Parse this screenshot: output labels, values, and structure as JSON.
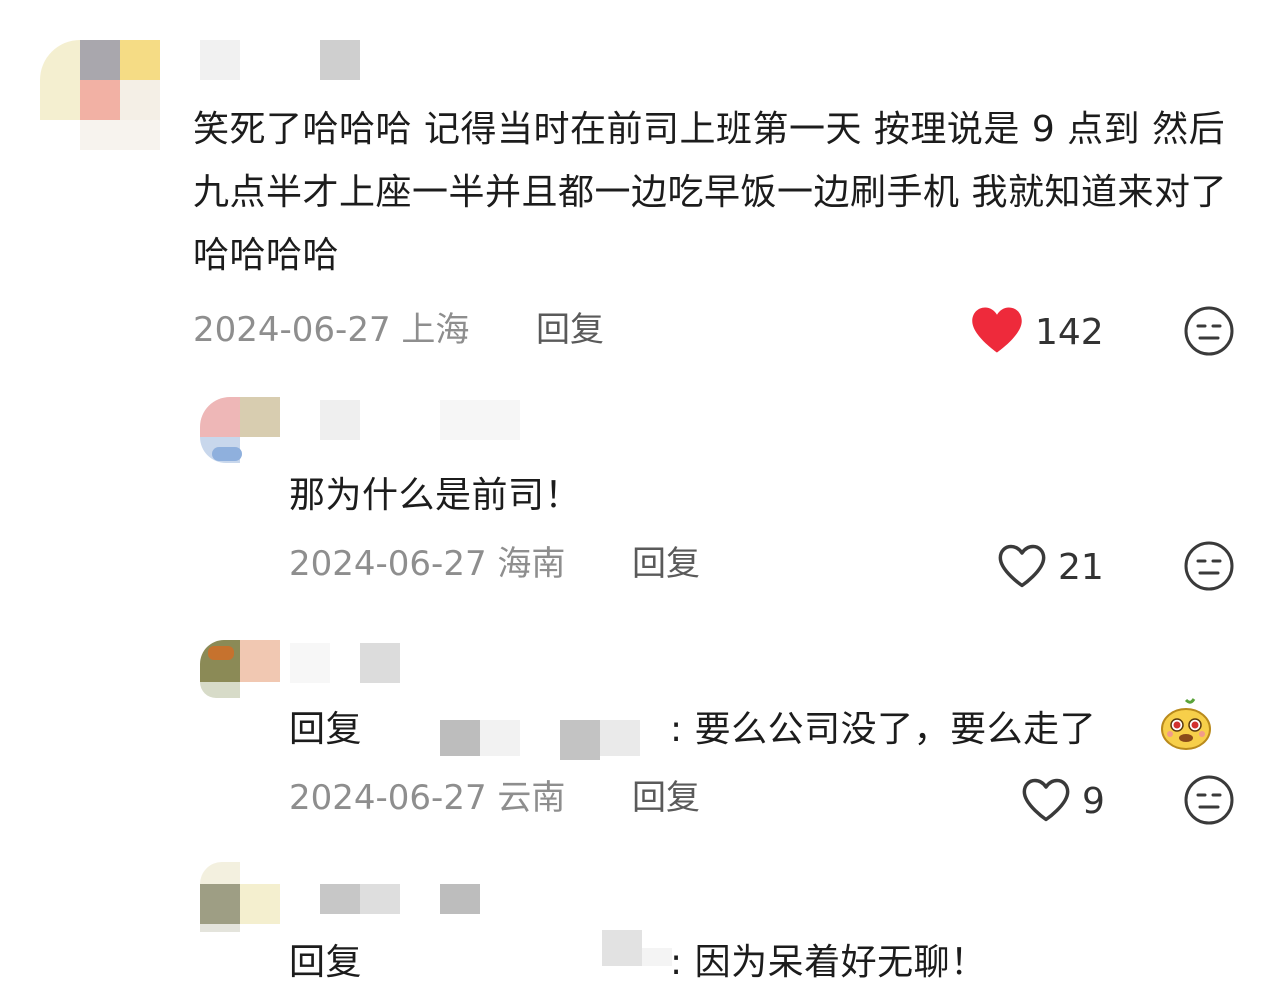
{
  "comments": [
    {
      "text": "笑死了哈哈哈 记得当时在前司上班第一天 按理说是 9 点到 然后九点半才上座一半并且都一边吃早饭一边刷手机 我就知道来对了哈哈哈哈",
      "date": "2024-06-27",
      "location": "上海",
      "reply_label": "回复",
      "likes": "142",
      "liked": true,
      "replies": [
        {
          "text": "那为什么是前司！",
          "date": "2024-06-27",
          "location": "海南",
          "reply_label": "回复",
          "likes": "21"
        },
        {
          "prefix": "回复",
          "text": ": 要么公司没了，要么走了",
          "date": "2024-06-27",
          "location": "云南",
          "reply_label": "回复",
          "likes": "9"
        },
        {
          "prefix": "回复",
          "text": ": 因为呆着好无聊！"
        }
      ]
    }
  ],
  "icons": {
    "like_filled": "heart-filled-icon",
    "like_outline": "heart-outline-icon",
    "dislike": "meh-face-icon",
    "emoji": "smiling-creature-emoji"
  },
  "colors": {
    "heart_red": "#ee2a3b",
    "meta_gray": "#8e8e8e"
  }
}
